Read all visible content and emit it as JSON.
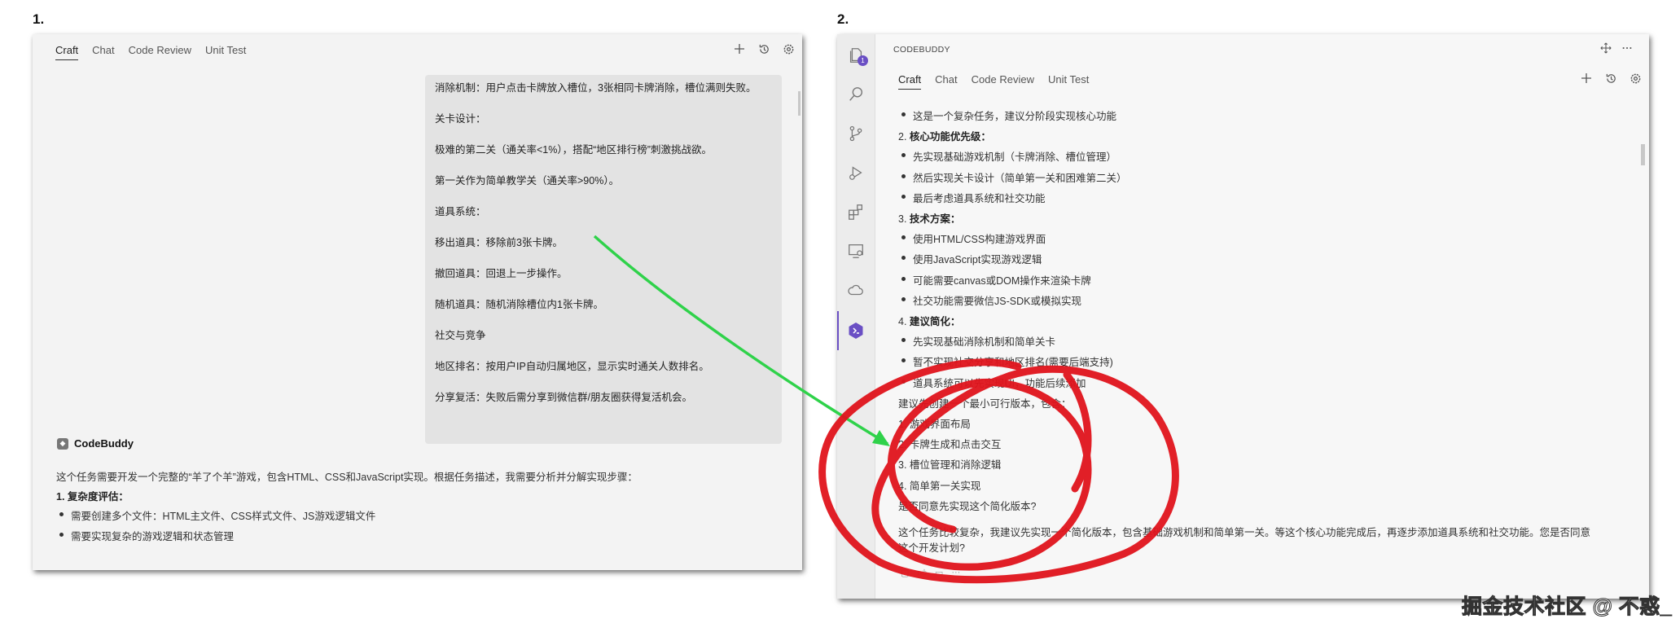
{
  "labels": {
    "step1": "1.",
    "step2": "2."
  },
  "panel1": {
    "tabs": [
      "Craft",
      "Chat",
      "Code Review",
      "Unit Test"
    ],
    "toolbar_icons": [
      "plus-icon",
      "history-icon",
      "gear-icon"
    ],
    "user_message_lines": [
      "消除机制：用户点击卡牌放入槽位，3张相同卡牌消除，槽位满则失败。",
      "关卡设计：",
      "极难的第二关（通关率<1%），搭配“地区排行榜”刺激挑战欲。",
      "第一关作为简单教学关（通关率>90%）。",
      "道具系统：",
      "移出道具：移除前3张卡牌。",
      "撤回道具：回退上一步操作。",
      "随机道具：随机消除槽位内1张卡牌。",
      "社交与竞争",
      "地区排名：按用户IP自动归属地区，显示实时通关人数排名。",
      "分享复活：失败后需分享到微信群/朋友圈获得复活机会。"
    ],
    "assistant_name": "CodeBuddy",
    "assistant_intro": "这个任务需要开发一个完整的“羊了个羊”游戏，包含HTML、CSS和JavaScript实现。根据任务描述，我需要分析并分解实现步骤：",
    "complexity_heading": "1. 复杂度评估：",
    "complexity_items": [
      "需要创建多个文件：HTML主文件、CSS样式文件、JS游戏逻辑文件",
      "需要实现复杂的游戏逻辑和状态管理"
    ]
  },
  "panel2": {
    "title": "CODEBUDDY",
    "tabs": [
      "Craft",
      "Chat",
      "Code Review",
      "Unit Test"
    ],
    "badge_count": "1",
    "lines": [
      {
        "kind": "bullet",
        "text": "这是一个复杂任务，建议分阶段实现核心功能"
      },
      {
        "kind": "heading",
        "num": "2. ",
        "text": "核心功能优先级："
      },
      {
        "kind": "bullet",
        "text": "先实现基础游戏机制（卡牌消除、槽位管理）"
      },
      {
        "kind": "bullet",
        "text": "然后实现关卡设计（简单第一关和困难第二关）"
      },
      {
        "kind": "bullet",
        "text": "最后考虑道具系统和社交功能"
      },
      {
        "kind": "heading",
        "num": "3. ",
        "text": "技术方案："
      },
      {
        "kind": "bullet",
        "text": "使用HTML/CSS构建游戏界面"
      },
      {
        "kind": "bullet",
        "text": "使用JavaScript实现游戏逻辑"
      },
      {
        "kind": "bullet",
        "text": "可能需要canvas或DOM操作来渲染卡牌"
      },
      {
        "kind": "bullet",
        "text": "社交功能需要微信JS-SDK或模拟实现"
      },
      {
        "kind": "heading",
        "num": "4. ",
        "text": "建议简化："
      },
      {
        "kind": "bullet",
        "text": "先实现基础消除机制和简单关卡"
      },
      {
        "kind": "bullet",
        "text": "暂不实现社交分享和地区排名(需要后端支持)"
      },
      {
        "kind": "bullet",
        "text": "道具系统可以先实现UI，功能后续添加"
      },
      {
        "kind": "plain",
        "text": "建议先创建一个最小可行版本，包含："
      },
      {
        "kind": "plain",
        "text": "1. 游戏界面布局"
      },
      {
        "kind": "plain",
        "text": "2. 卡牌生成和点击交互"
      },
      {
        "kind": "plain",
        "text": "3. 槽位管理和消除逻辑"
      },
      {
        "kind": "plain",
        "text": "4. 简单第一关实现"
      },
      {
        "kind": "plain",
        "text": "是否同意先实现这个简化版本?"
      }
    ],
    "closing_line1": "这个任务比较复杂，我建议先实现一个简化版本，包含基础游戏机制和简单第一关。等这个核心功能完成后，再逐步添加道具系统和社交功能。您是否同意",
    "closing_line2": "这个开发计划?"
  },
  "watermark": "掘金技术社区 @ 不惑_",
  "colors": {
    "accent": "#6a4fc4",
    "arrow": "#2fd24a",
    "scribble": "#e0141c"
  }
}
